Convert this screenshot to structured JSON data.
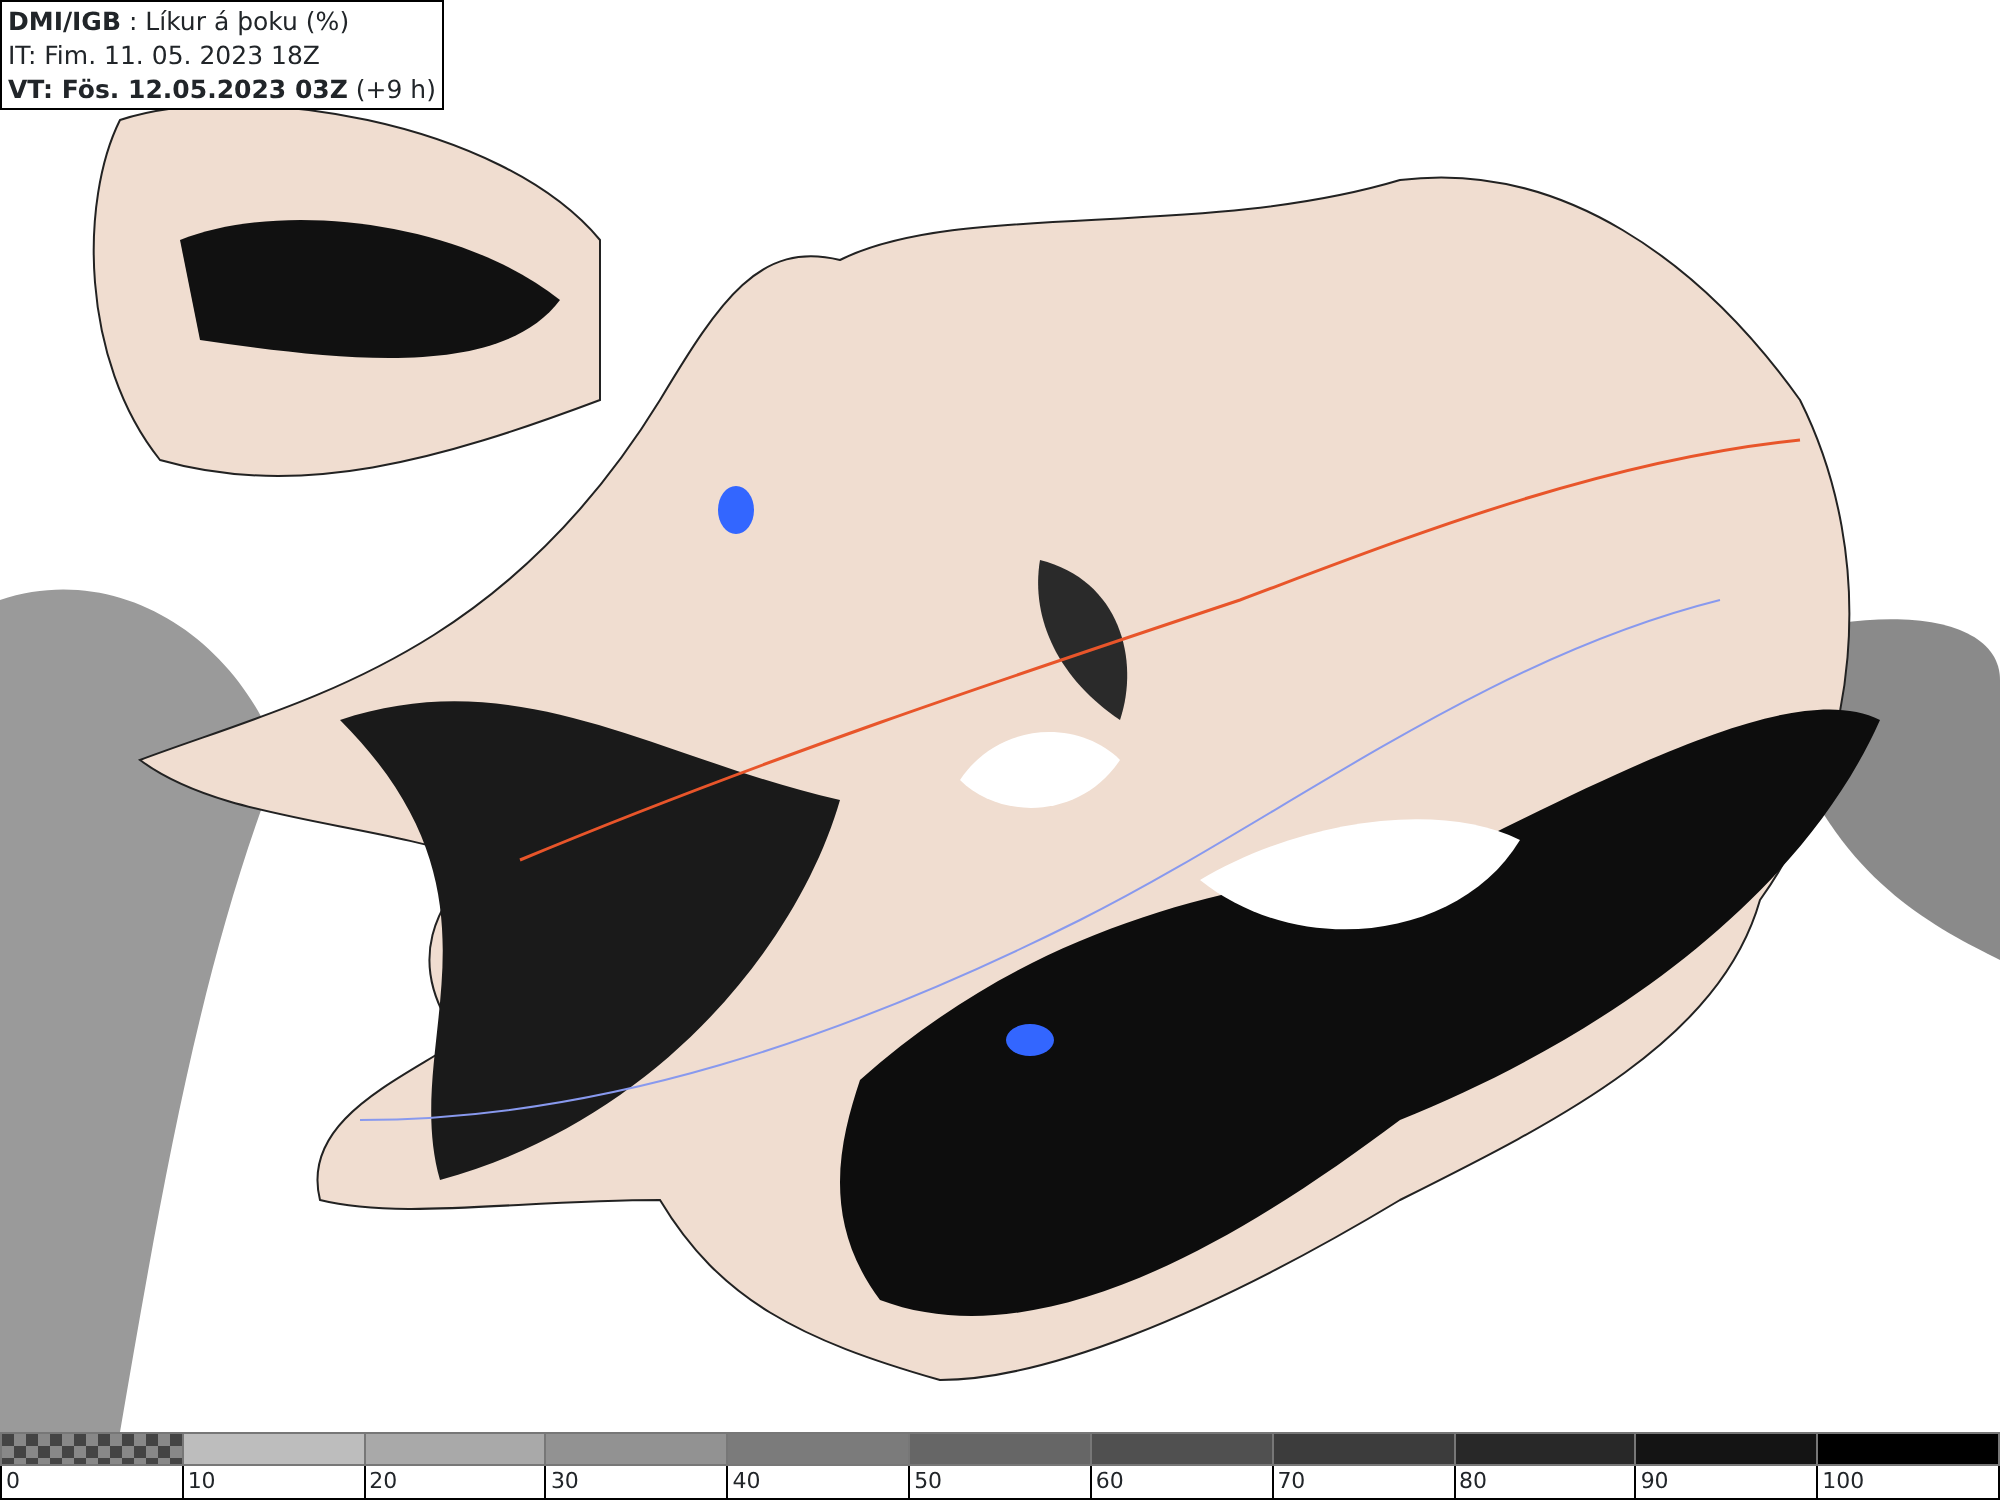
{
  "header": {
    "lines": [
      "**DMI/IGB** : Líkur á þoku (%)",
      "IT: Fim. 11. 05. 2023 18Z",
      "**VT: Fös. 12.05.2023 03Z** (+9 h)"
    ]
  },
  "legend": {
    "segments": [
      {
        "kind": "checker"
      },
      {
        "kind": "solid",
        "color": "#bdbdbd"
      },
      {
        "kind": "solid",
        "color": "#a9a9a9"
      },
      {
        "kind": "solid",
        "color": "#929292"
      },
      {
        "kind": "solid",
        "color": "#7b7b7b"
      },
      {
        "kind": "solid",
        "color": "#666666"
      },
      {
        "kind": "solid",
        "color": "#505050"
      },
      {
        "kind": "solid",
        "color": "#3c3c3c"
      },
      {
        "kind": "solid",
        "color": "#282828"
      },
      {
        "kind": "solid",
        "color": "#141414"
      },
      {
        "kind": "solid",
        "color": "#000000"
      }
    ],
    "ticks": [
      "0",
      "10",
      "20",
      "30",
      "40",
      "50",
      "60",
      "70",
      "80",
      "90",
      "100"
    ]
  }
}
